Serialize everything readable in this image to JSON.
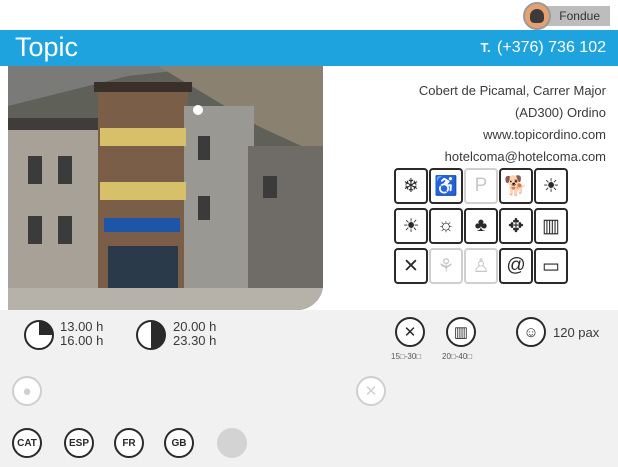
{
  "category_tag": {
    "label": "Fondue",
    "icon": "chef-icon"
  },
  "header": {
    "title": "Topic",
    "phone_prefix": "T.",
    "phone": "(+376) 736 102"
  },
  "photo": {
    "icon": "hotel-building-photo"
  },
  "address": {
    "line1": "Cobert de Picamal, Carrer Major",
    "line2": "(AD300) Ordino",
    "website": "www.topicordino.com",
    "email": "hotelcoma@hotelcoma.com"
  },
  "amenities": [
    {
      "name": "air-conditioning-icon",
      "glyph": "❄",
      "active": true
    },
    {
      "name": "wheelchair-access-icon",
      "glyph": "♿",
      "active": true
    },
    {
      "name": "parking-icon",
      "glyph": "P",
      "active": false
    },
    {
      "name": "pets-allowed-icon",
      "glyph": "🐕",
      "active": true
    },
    {
      "name": "terrace-sun-icon",
      "glyph": "☀",
      "active": true
    },
    {
      "name": "sun-icon",
      "glyph": "☀",
      "active": true
    },
    {
      "name": "sun-view-icon",
      "glyph": "☼",
      "active": true
    },
    {
      "name": "forest-view-icon",
      "glyph": "♣",
      "active": true
    },
    {
      "name": "central-location-icon",
      "glyph": "✥",
      "active": true
    },
    {
      "name": "menu-book-icon",
      "glyph": "▥",
      "active": true
    },
    {
      "name": "cutlery-icon",
      "glyph": "✕",
      "active": true
    },
    {
      "name": "gluten-free-icon",
      "glyph": "⚘",
      "active": false
    },
    {
      "name": "chef-service-icon",
      "glyph": "♙",
      "active": false
    },
    {
      "name": "email-icon",
      "glyph": "@",
      "active": true
    },
    {
      "name": "credit-card-icon",
      "glyph": "▭",
      "active": true
    }
  ],
  "schedule": {
    "lunch_open": "13.00 h",
    "lunch_close": "16.00 h",
    "dinner_open": "20.00 h",
    "dinner_close": "23.30 h"
  },
  "pricing": {
    "menu_price": "15□-30□",
    "carte_price": "20□-40□",
    "capacity": "120 pax"
  },
  "languages": [
    "CAT",
    "ESP",
    "FR",
    "GB"
  ]
}
